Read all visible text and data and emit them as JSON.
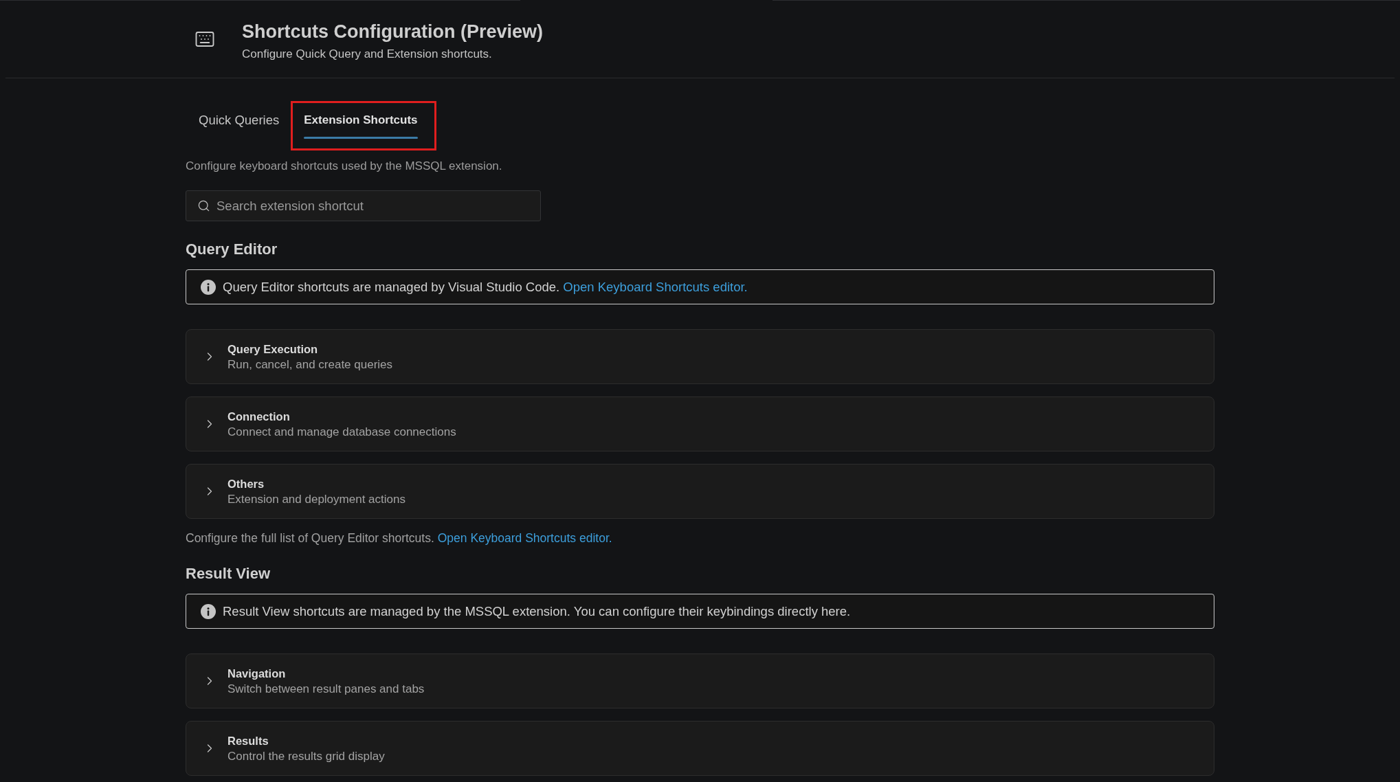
{
  "header": {
    "title": "Shortcuts Configuration (Preview)",
    "subtitle": "Configure Quick Query and Extension shortcuts."
  },
  "tabs": [
    {
      "label": "Quick Queries",
      "selected": false,
      "highlighted": false
    },
    {
      "label": "Extension Shortcuts",
      "selected": true,
      "highlighted": true
    }
  ],
  "description": "Configure keyboard shortcuts used by the MSSQL extension.",
  "search": {
    "placeholder": "Search extension shortcut"
  },
  "sections": [
    {
      "heading": "Query Editor",
      "notice": {
        "text": "Query Editor shortcuts are managed by Visual Studio Code.",
        "link": "Open Keyboard Shortcuts editor."
      },
      "groups": [
        {
          "title": "Query Execution",
          "subtitle": "Run, cancel, and create queries",
          "expanded": false
        },
        {
          "title": "Connection",
          "subtitle": "Connect and manage database connections",
          "expanded": false
        },
        {
          "title": "Others",
          "subtitle": "Extension and deployment actions",
          "expanded": false
        }
      ],
      "footnote": {
        "text": "Configure the full list of Query Editor shortcuts.",
        "link": "Open Keyboard Shortcuts editor."
      }
    },
    {
      "heading": "Result View",
      "notice": {
        "text": "Result View shortcuts are managed by the MSSQL extension. You can configure their keybindings directly here."
      },
      "groups": [
        {
          "title": "Navigation",
          "subtitle": "Switch between result panes and tabs",
          "expanded": false
        },
        {
          "title": "Results",
          "subtitle": "Control the results grid display",
          "expanded": false
        }
      ]
    }
  ]
}
